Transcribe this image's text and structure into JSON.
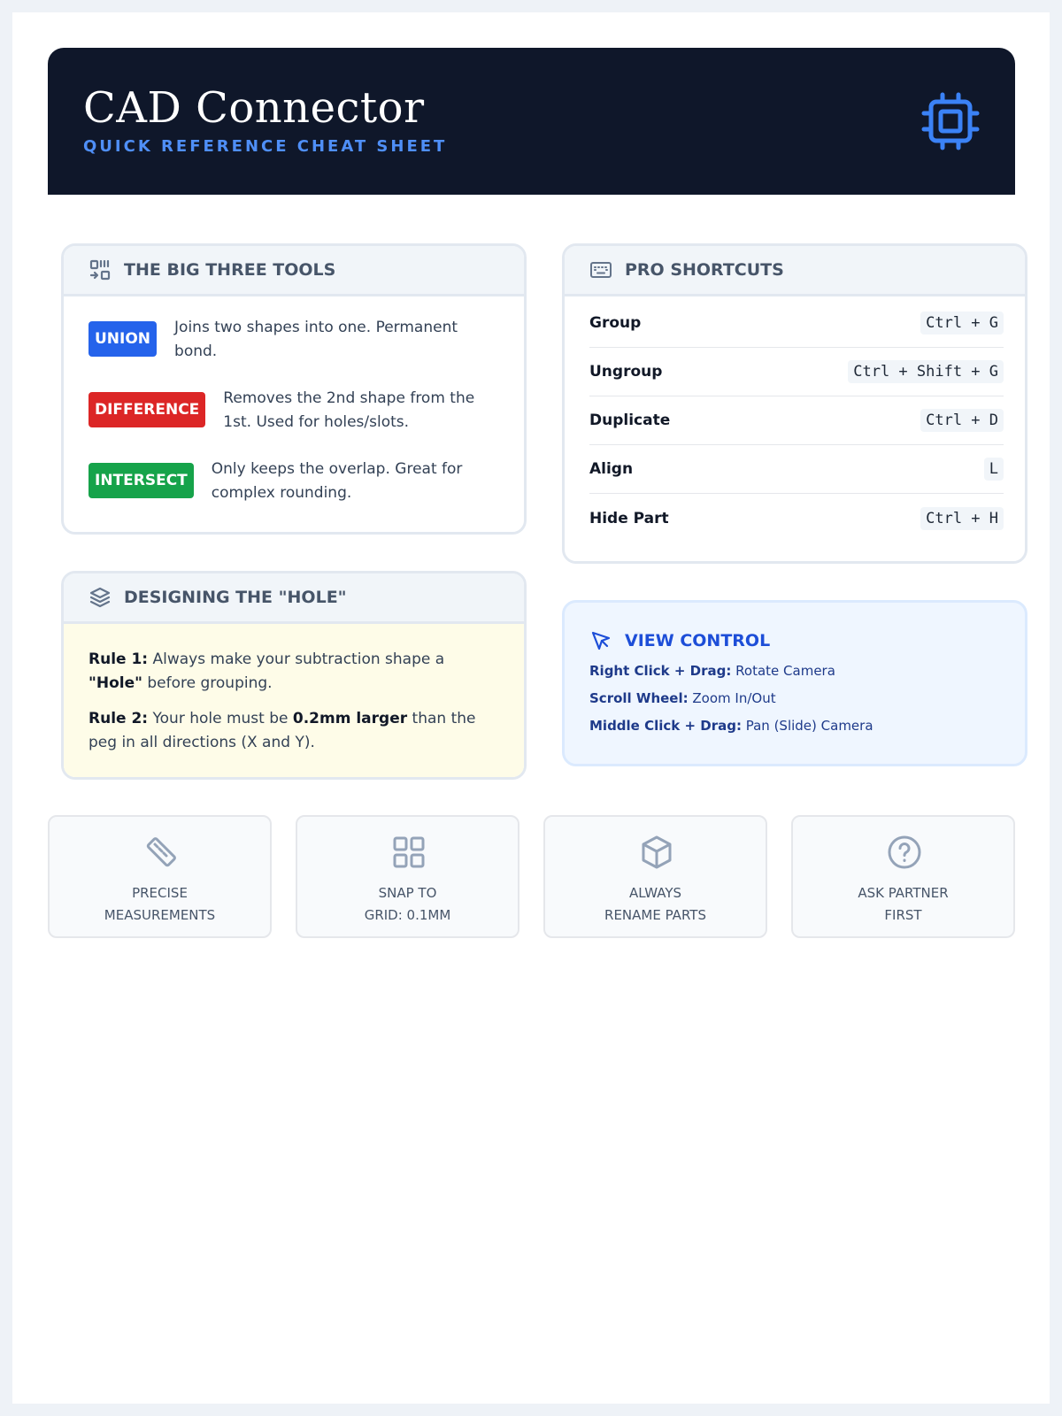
{
  "header": {
    "title": "CAD Connector",
    "subtitle": "QUICK REFERENCE CHEAT SHEET",
    "icon": "cpu-chip-icon",
    "accent_color": "#4f8ff7",
    "background_color": "#0f172a"
  },
  "big_three": {
    "title": "THE BIG THREE TOOLS",
    "icon": "tools-icon",
    "tools": [
      {
        "badge": "UNION",
        "color": "#2563eb",
        "desc_line1": "Joins two shapes into one. Permanent",
        "desc_line2": "bond."
      },
      {
        "badge": "DIFFERENCE",
        "color": "#dc2626",
        "desc_line1": "Removes the 2nd shape from the",
        "desc_line2": "1st. Used for holes/slots."
      },
      {
        "badge": "INTERSECT",
        "color": "#16a34a",
        "desc_line1": "Only keeps the overlap. Great for",
        "desc_line2": "complex rounding."
      }
    ]
  },
  "hole": {
    "title": "DESIGNING THE \"HOLE\"",
    "icon": "layers-icon",
    "rule1_label": "Rule 1:",
    "rule1_text_a": " Always make your subtraction shape a ",
    "rule1_bold": "\"Hole\"",
    "rule1_text_b": " before grouping.",
    "rule2_label": "Rule 2:",
    "rule2_text_a": " Your hole must be ",
    "rule2_bold": "0.2mm larger",
    "rule2_text_b": " than the peg in all directions (X and Y)."
  },
  "shortcuts": {
    "title": "PRO SHORTCUTS",
    "icon": "keyboard-icon",
    "items": [
      {
        "name": "Group",
        "keys": "Ctrl + G"
      },
      {
        "name": "Ungroup",
        "keys": "Ctrl + Shift + G"
      },
      {
        "name": "Duplicate",
        "keys": "Ctrl + D"
      },
      {
        "name": "Align",
        "keys": "L"
      },
      {
        "name": "Hide Part",
        "keys": "Ctrl + H"
      }
    ]
  },
  "view_control": {
    "title": "VIEW CONTROL",
    "icon": "cursor-pointer-icon",
    "lines": [
      {
        "label": "Right Click + Drag:",
        "value": " Rotate Camera"
      },
      {
        "label": "Scroll Wheel:",
        "value": " Zoom In/Out"
      },
      {
        "label": "Middle Click + Drag:",
        "value": " Pan (Slide) Camera"
      }
    ]
  },
  "tips": [
    {
      "icon": "ruler-icon",
      "line1": "PRECISE",
      "line2": "MEASUREMENTS"
    },
    {
      "icon": "grid-icon",
      "line1": "SNAP TO",
      "line2": "GRID: 0.1MM"
    },
    {
      "icon": "cube-icon",
      "line1": "ALWAYS",
      "line2": "RENAME PARTS"
    },
    {
      "icon": "question-circle-icon",
      "line1": "ASK PARTNER",
      "line2": "FIRST"
    }
  ]
}
